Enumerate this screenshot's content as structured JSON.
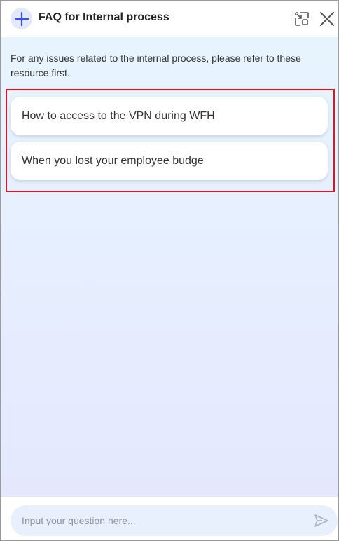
{
  "header": {
    "title": "FAQ for Internal process",
    "new_chat_icon": "plus-icon",
    "minimize_icon": "minimize-window-icon",
    "close_icon": "close-icon"
  },
  "intro_text": "For any issues related to the internal process, please refer to these resource first.",
  "faq_items": [
    {
      "label": "How to access to the VPN during WFH"
    },
    {
      "label": "When you lost your employee budge"
    }
  ],
  "composer": {
    "placeholder": "Input your question here...",
    "value": "",
    "send_icon": "send-icon"
  },
  "colors": {
    "accent": "#3155e6",
    "highlight_border": "#e1141d",
    "icon_gray": "#555555",
    "send_icon": "#a7b2c6"
  }
}
